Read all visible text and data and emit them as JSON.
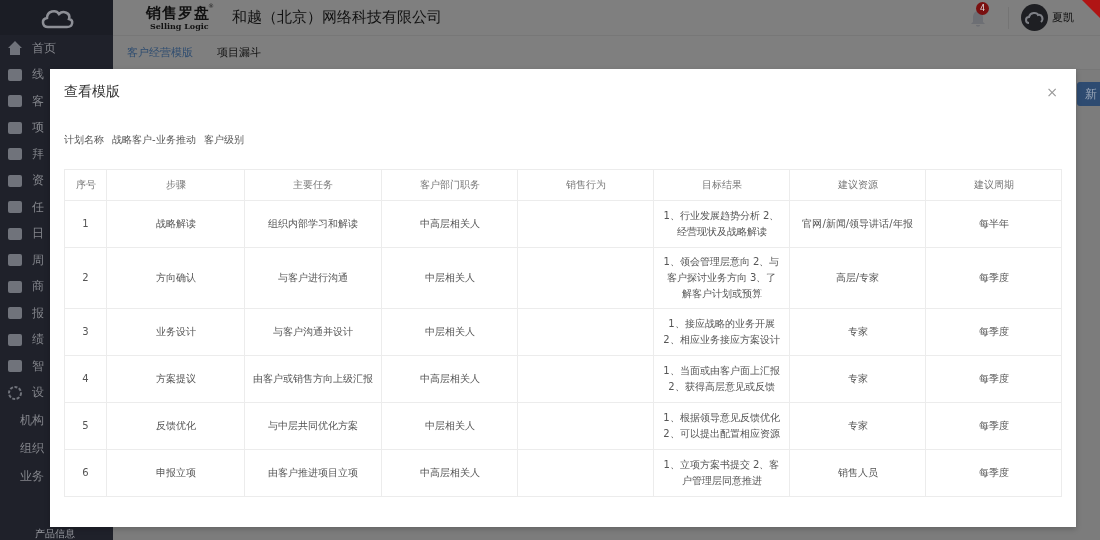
{
  "brand": {
    "name": "销售罗盘",
    "mark": "®",
    "sub": "Selling Logic"
  },
  "company": "和越（北京）网络科技有限公司",
  "notifications": {
    "count": "4"
  },
  "user": {
    "name": "夏凯"
  },
  "sidebar": {
    "items": [
      {
        "label": "首页"
      },
      {
        "label": "线"
      },
      {
        "label": "客"
      },
      {
        "label": "项"
      },
      {
        "label": "拜"
      },
      {
        "label": "资"
      },
      {
        "label": "任"
      },
      {
        "label": "日"
      },
      {
        "label": "周"
      },
      {
        "label": "商"
      },
      {
        "label": "报"
      },
      {
        "label": "绩"
      },
      {
        "label": "智"
      },
      {
        "label": "设",
        "children": [
          {
            "label": "机构"
          },
          {
            "label": "组织"
          },
          {
            "label": "业务",
            "children": [
              {
                "label": "产品信息"
              }
            ]
          }
        ]
      }
    ]
  },
  "tabs": [
    {
      "label": "客户经营模版",
      "selected": true
    },
    {
      "label": "项目漏斗",
      "selected": false
    }
  ],
  "new_button": "新",
  "modal": {
    "title": "查看模版",
    "close": "×",
    "plan": {
      "label": "计划名称",
      "name": "战略客户-业务推动",
      "level_label": "客户级别"
    },
    "table": {
      "columns": [
        "序号",
        "步骤",
        "主要任务",
        "客户部门职务",
        "销售行为",
        "目标结果",
        "建议资源",
        "建议周期"
      ],
      "rows": [
        {
          "no": "1",
          "step": "战略解读",
          "task": "组织内部学习和解读",
          "role": "中高层相关人",
          "target": "1、行业发展趋势分析 2、经营现状及战略解读",
          "resource": "官网/新闻/领导讲话/年报",
          "period": "每半年"
        },
        {
          "no": "2",
          "step": "方向确认",
          "task": "与客户进行沟通",
          "role": "中层相关人",
          "target": "1、领会管理层意向 2、与客户探讨业务方向 3、了解客户计划或预算",
          "resource": "高层/专家",
          "period": "每季度"
        },
        {
          "no": "3",
          "step": "业务设计",
          "task": "与客户沟通并设计",
          "role": "中层相关人",
          "target": "1、接应战略的业务开展 2、相应业务接应方案设计",
          "resource": "专家",
          "period": "每季度"
        },
        {
          "no": "4",
          "step": "方案提议",
          "task": "由客户或销售方向上级汇报",
          "role": "中高层相关人",
          "target": "1、当面或由客户面上汇报 2、获得高层意见或反馈",
          "resource": "专家",
          "period": "每季度"
        },
        {
          "no": "5",
          "step": "反馈优化",
          "task": "与中层共同优化方案",
          "role": "中层相关人",
          "target": "1、根据领导意见反馈优化 2、可以提出配置相应资源",
          "resource": "专家",
          "period": "每季度"
        },
        {
          "no": "6",
          "step": "申报立项",
          "task": "由客户推进项目立项",
          "role": "中高层相关人",
          "target": "1、立项方案书提交 2、客户管理层同意推进",
          "resource": "销售人员",
          "period": "每季度"
        }
      ]
    }
  }
}
